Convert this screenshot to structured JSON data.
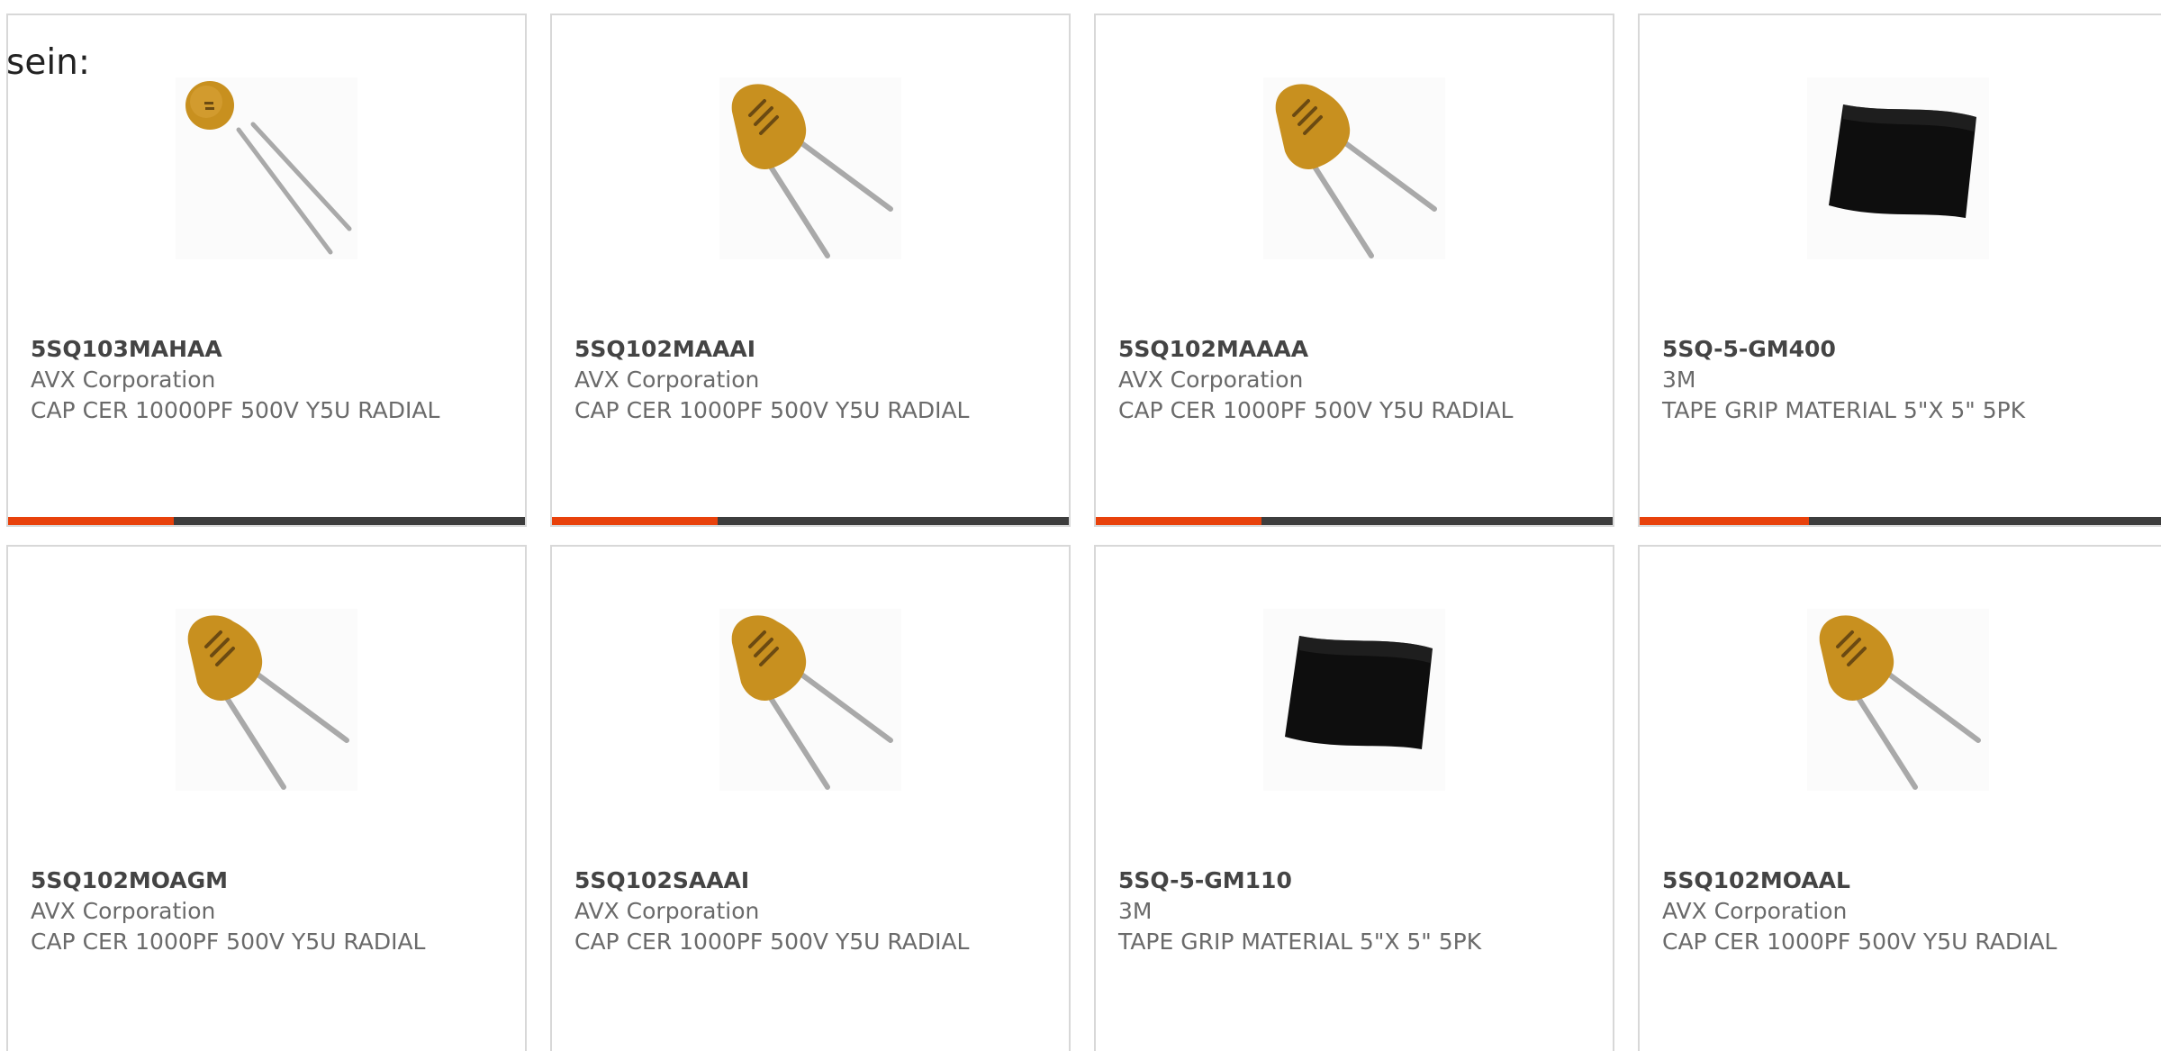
{
  "intro_text": "sein:",
  "colors": {
    "accent": "#e8410b",
    "bar_track": "#3d3d3d",
    "card_border": "#d8d8d8",
    "capacitor_body": "#c8901f"
  },
  "products": [
    {
      "part_number": "5SQ103MAHAA",
      "manufacturer": "AVX Corporation",
      "description": "CAP CER 10000PF 500V Y5U RADIAL",
      "image_icon": "ceramic-disc-capacitor-small",
      "progress": 0.32
    },
    {
      "part_number": "5SQ102MAAAI",
      "manufacturer": "AVX Corporation",
      "description": "CAP CER 1000PF 500V Y5U RADIAL",
      "image_icon": "ceramic-disc-capacitor",
      "progress": 0.32
    },
    {
      "part_number": "5SQ102MAAAA",
      "manufacturer": "AVX Corporation",
      "description": "CAP CER 1000PF 500V Y5U RADIAL",
      "image_icon": "ceramic-disc-capacitor",
      "progress": 0.32
    },
    {
      "part_number": "5SQ-5-GM400",
      "manufacturer": "3M",
      "description": "TAPE GRIP MATERIAL 5\"X 5\" 5PK",
      "image_icon": "grip-tape-sheet",
      "progress": 0.32
    },
    {
      "part_number": "5SQ102MOAGM",
      "manufacturer": "AVX Corporation",
      "description": "CAP CER 1000PF 500V Y5U RADIAL",
      "image_icon": "ceramic-disc-capacitor"
    },
    {
      "part_number": "5SQ102SAAAI",
      "manufacturer": "AVX Corporation",
      "description": "CAP CER 1000PF 500V Y5U RADIAL",
      "image_icon": "ceramic-disc-capacitor"
    },
    {
      "part_number": "5SQ-5-GM110",
      "manufacturer": "3M",
      "description": "TAPE GRIP MATERIAL 5\"X 5\" 5PK",
      "image_icon": "grip-tape-sheet"
    },
    {
      "part_number": "5SQ102MOAAL",
      "manufacturer": "AVX Corporation",
      "description": "CAP CER 1000PF 500V Y5U RADIAL",
      "image_icon": "ceramic-disc-capacitor"
    }
  ]
}
